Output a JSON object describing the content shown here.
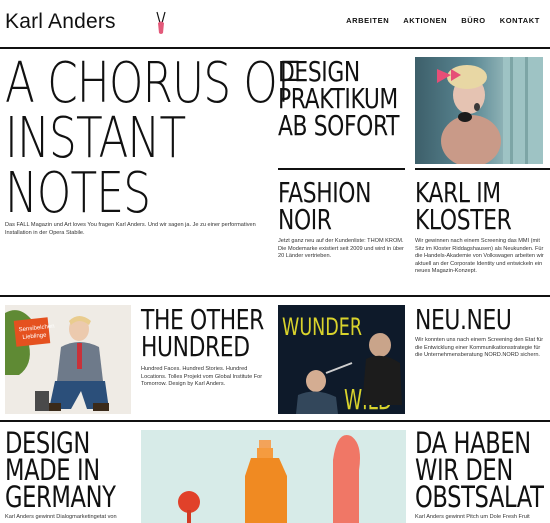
{
  "header": {
    "logo": "Karl Anders",
    "nav": [
      "ARBEITEN",
      "AKTIONEN",
      "BÜRO",
      "KONTAKT"
    ]
  },
  "hero": {
    "lines": [
      "A CHORUS OF",
      "INSTANT",
      "NOTES"
    ],
    "text": "Das FALL Magazin und Art loves You fragen Karl Anders. Und wir sagen ja. Je zu einer performativen Installation in der Opera Stabile."
  },
  "tiles": {
    "design_praktikum": {
      "lines": [
        "DESIGN",
        "PRAKTIKUM",
        "AB SOFORT"
      ]
    },
    "fashion_noir": {
      "lines": [
        "FASHION",
        "NOIR"
      ],
      "text": "Jetzt ganz neu auf der Kundenliste: THOM KROM. Die Modemarke existiert seit 2009 und wird in über 20 Länder vertrieben."
    },
    "karl_kloster": {
      "lines": [
        "KARL IM",
        "KLOSTER"
      ],
      "text": "Wir gewinnen nach einem Screening das MMI (mit Sitz im Kloster Riddagshausen) als Neukunden. Für die Handels-Akademie von Volkswagen arbeiten wir aktuell an der Corporate Identity und entwickeln ein neues Magazin-Konzept."
    },
    "other_hundred": {
      "lines": [
        "THE OTHER",
        "HUNDRED"
      ],
      "text": "Hundred Faces. Hundred Stories. Hundred Locations. Tolles Projekt vom Global Institute For Tomorrow. Design by Karl Anders."
    },
    "neu_neu": {
      "lines": [
        "NEU.NEU"
      ],
      "text": "Wir konnten uns nach einem Screening den Etat für die Entwicklung einer Kommunikationsstrategie für die Unternehmensberatung NORD.NORD sichern."
    },
    "design_germany": {
      "lines": [
        "DESIGN",
        "MADE IN",
        "GERMANY"
      ],
      "text": "Karl Anders gewinnt Dialogmarketingetat von"
    },
    "obstsalat": {
      "lines": [
        "DA HABEN",
        "WIR DEN",
        "OBSTSALAT"
      ],
      "text": "Karl Anders gewinnt Pitch um Dole Fresh Fruit"
    }
  },
  "images": {
    "person_sign": "Sensibelchen Lieblinge",
    "wunder_top": "WUNDER",
    "wunder_bottom": "WILD"
  }
}
